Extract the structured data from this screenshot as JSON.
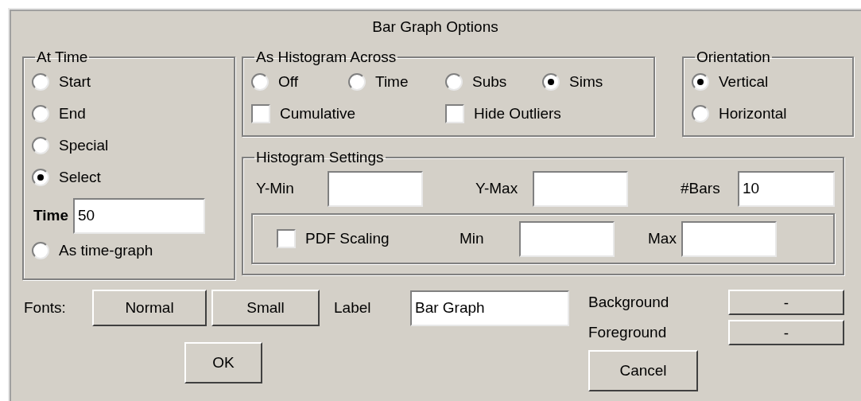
{
  "window": {
    "title": "Bar Graph Options"
  },
  "at_time": {
    "title": "At Time",
    "options": [
      {
        "label": "Start",
        "selected": false
      },
      {
        "label": "End",
        "selected": false
      },
      {
        "label": "Special",
        "selected": false
      },
      {
        "label": "Select",
        "selected": true
      }
    ],
    "time": {
      "label": "Time",
      "value": "50"
    },
    "as_time_graph": {
      "label": "As time-graph",
      "selected": false
    }
  },
  "histogram_across": {
    "title": "As Histogram Across",
    "options": [
      {
        "label": "Off",
        "selected": false
      },
      {
        "label": "Time",
        "selected": false
      },
      {
        "label": "Subs",
        "selected": false
      },
      {
        "label": "Sims",
        "selected": true
      }
    ],
    "checkboxes": [
      {
        "label": "Cumulative",
        "checked": false
      },
      {
        "label": "Hide Outliers",
        "checked": false
      }
    ]
  },
  "orientation": {
    "title": "Orientation",
    "options": [
      {
        "label": "Vertical",
        "selected": true
      },
      {
        "label": "Horizontal",
        "selected": false
      }
    ]
  },
  "histogram_settings": {
    "title": "Histogram Settings",
    "fields": [
      {
        "label": "Y-Min"
      },
      {
        "label": "Y-Max"
      },
      {
        "label": "#Bars",
        "value": "10"
      }
    ],
    "pdf_scaling": {
      "label": "PDF Scaling",
      "checked": false
    },
    "range_fields": [
      {
        "label": "Min"
      },
      {
        "label": "Max"
      }
    ]
  },
  "fonts": {
    "label": "Fonts:",
    "buttons": [
      "Normal",
      "Small"
    ]
  },
  "label_field": {
    "label": "Label",
    "value": "Bar Graph"
  },
  "colors": [
    {
      "label": "Background",
      "button": "-"
    },
    {
      "label": "Foreground",
      "button": "-"
    }
  ],
  "ok": "OK",
  "cancel": "Cancel"
}
